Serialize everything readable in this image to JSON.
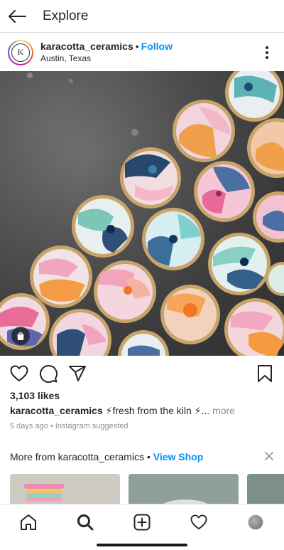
{
  "topbar": {
    "title": "Explore",
    "back_icon": "arrow-left-icon"
  },
  "post": {
    "avatar_letter": "K",
    "username": "karacotta_ceramics",
    "separator": "•",
    "follow_label": "Follow",
    "location": "Austin, Texas",
    "more_icon": "more-vertical-icon",
    "photo_description_icon": "shopping-bag-icon",
    "likes": "3,103 likes",
    "caption_user": "karacotta_ceramics",
    "caption_text": " ⚡fresh from the kiln ⚡...",
    "caption_more": " more",
    "meta": "5 days ago • Instagram suggested"
  },
  "actions": {
    "like_icon": "heart-icon",
    "comment_icon": "comment-icon",
    "share_icon": "send-icon",
    "save_icon": "bookmark-icon"
  },
  "more_from": {
    "prefix": "More from karacotta_ceramics • ",
    "shop_label": "View Shop",
    "close_icon": "close-icon"
  },
  "bottom_nav": {
    "items": [
      "home-icon",
      "search-icon",
      "add-post-icon",
      "activity-heart-icon",
      "profile-avatar"
    ]
  },
  "colors": {
    "link_blue": "#0095f6",
    "text": "#262626",
    "muted": "#8e8e8e",
    "divider": "#dbdbdb"
  }
}
